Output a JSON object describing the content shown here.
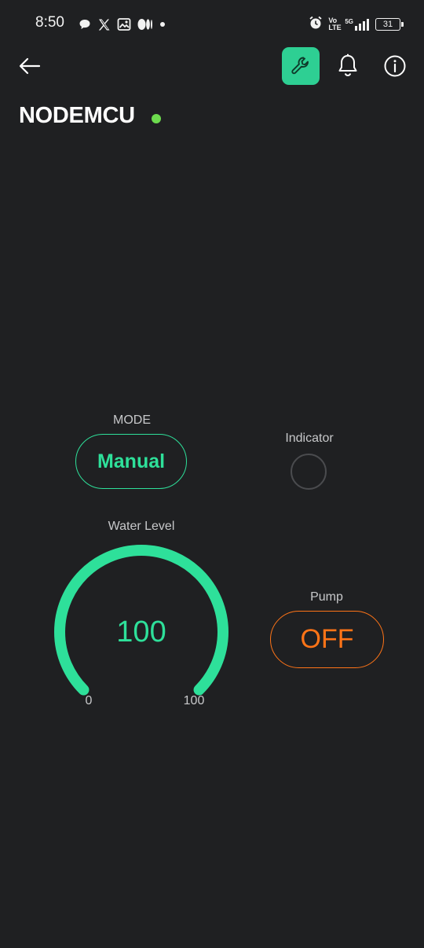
{
  "status_bar": {
    "time": "8:50",
    "notification_icons": [
      "chat-bubble-icon",
      "x-logo-icon",
      "gallery-icon",
      "medium-logo-icon",
      "dot-icon"
    ],
    "right_icons": [
      "alarm-icon",
      "volte-icon",
      "5g-signal-icon"
    ],
    "volte_label": "Vo LTE",
    "network_label": "5G",
    "battery": "31"
  },
  "header": {
    "back_icon": "arrow-left-icon",
    "settings_icon": "wrench-icon",
    "notifications_icon": "bell-icon",
    "info_icon": "info-icon",
    "accent_color": "#2ecf93"
  },
  "device": {
    "title": "NODEMCU",
    "status_color": "#6ddb4e"
  },
  "widgets": {
    "mode": {
      "label": "MODE",
      "value": "Manual",
      "color": "#2ee09a"
    },
    "indicator": {
      "label": "Indicator",
      "state": "off",
      "color": "#4a4b4e"
    },
    "water_level": {
      "label": "Water Level",
      "value": "100",
      "min": "0",
      "max": "100",
      "fraction": 1.0,
      "color": "#2ee09a"
    },
    "pump": {
      "label": "Pump",
      "value": "OFF",
      "color": "#ff7417"
    }
  }
}
